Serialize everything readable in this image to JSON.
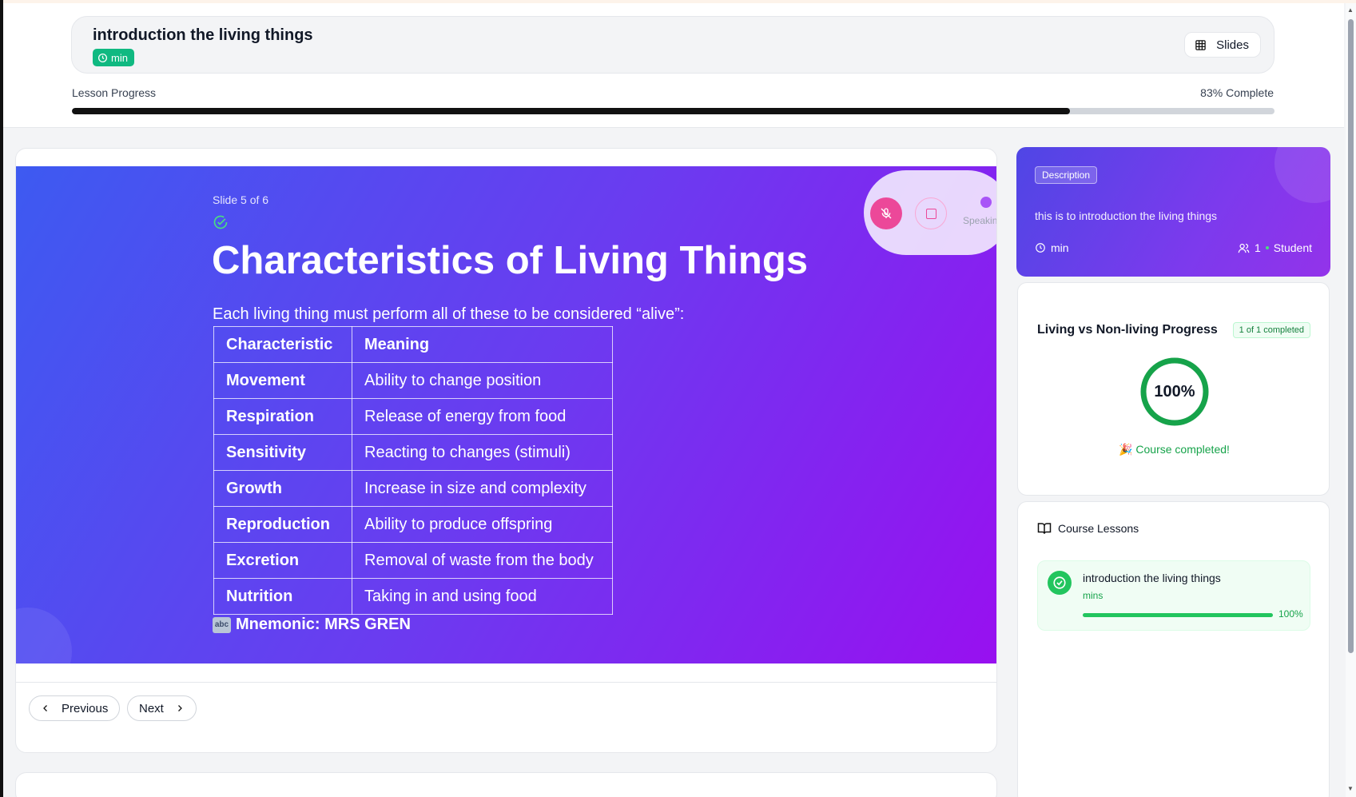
{
  "header": {
    "title": "introduction the living things",
    "time_badge": "min",
    "slides_button": "Slides"
  },
  "lesson_progress": {
    "label": "Lesson Progress",
    "percent_text": "83% Complete",
    "value": 0.83
  },
  "slide": {
    "counter": "Slide 5 of 6",
    "heading": "Characteristics of Living Things",
    "intro": "Each living thing must perform all of these to be considered “alive”:",
    "table": {
      "headers": [
        "Characteristic",
        "Meaning"
      ],
      "rows": [
        [
          "Movement",
          "Ability to change position"
        ],
        [
          "Respiration",
          "Release of energy from food"
        ],
        [
          "Sensitivity",
          "Reacting to changes (stimuli)"
        ],
        [
          "Growth",
          "Increase in size and complexity"
        ],
        [
          "Reproduction",
          "Ability to produce offspring"
        ],
        [
          "Excretion",
          "Removal of waste from the body"
        ],
        [
          "Nutrition",
          "Taking in and using food"
        ]
      ]
    },
    "mnemonic_icon": "abc",
    "mnemonic": "Mnemonic: MRS GREN"
  },
  "voice_controls": {
    "status": "Speaking",
    "mic_icon": "mic-off-icon",
    "stop_icon": "stop-icon"
  },
  "navigation": {
    "previous": "Previous",
    "next": "Next"
  },
  "description": {
    "badge": "Description",
    "text": "this is to introduction the living things",
    "duration": "min",
    "participants": "1",
    "role": "Student"
  },
  "course_progress": {
    "title": "Living vs Non-living Progress",
    "badge": "1 of 1 completed",
    "percent_text": "100%",
    "value": 1.0,
    "message": "🎉 Course completed!"
  },
  "course_lessons": {
    "title": "Course Lessons",
    "items": [
      {
        "name": "introduction the living things",
        "duration": "mins",
        "percent_text": "100%",
        "value": 1.0
      }
    ]
  },
  "colors": {
    "accent_green": "#10b981",
    "slide_gradient_start": "#3d5af1",
    "slide_gradient_end": "#9810f0",
    "mic_pink": "#ec4899"
  }
}
